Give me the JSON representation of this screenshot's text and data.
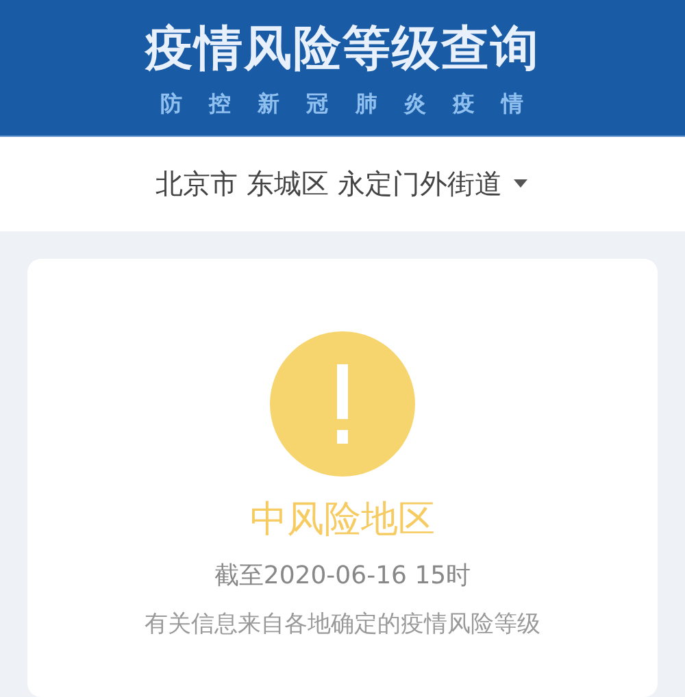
{
  "header": {
    "title": "疫情风险等级查询",
    "subtitle": "防 控 新 冠 肺 炎 疫 情"
  },
  "location": {
    "text": "北京市 东城区 永定门外街道"
  },
  "result": {
    "kind": "medium",
    "label": "中风险地区",
    "updated": "截至2020-06-16 15时",
    "note": "有关信息来自各地确定的疫情风险等级"
  }
}
